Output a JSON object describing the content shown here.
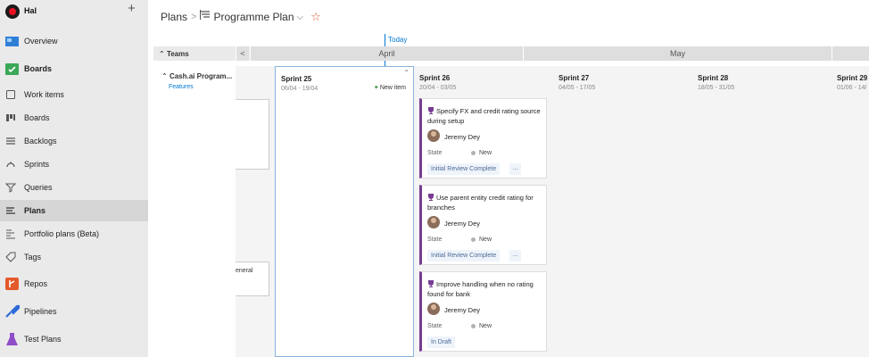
{
  "sidebar": {
    "org_name": "Hal",
    "add_label": "+",
    "items": [
      {
        "label": "Overview",
        "icon": "overview-icon"
      },
      {
        "label": "Boards",
        "icon": "boards-hub-icon"
      },
      {
        "label": "Work items",
        "icon": "work-items-icon"
      },
      {
        "label": "Boards",
        "icon": "boards-icon"
      },
      {
        "label": "Backlogs",
        "icon": "backlogs-icon"
      },
      {
        "label": "Sprints",
        "icon": "sprints-icon"
      },
      {
        "label": "Queries",
        "icon": "queries-icon"
      },
      {
        "label": "Plans",
        "icon": "plans-icon"
      },
      {
        "label": "Portfolio plans (Beta)",
        "icon": "portfolio-plans-icon"
      },
      {
        "label": "Tags",
        "icon": "tags-icon"
      },
      {
        "label": "Repos",
        "icon": "repos-icon"
      },
      {
        "label": "Pipelines",
        "icon": "pipelines-icon"
      },
      {
        "label": "Test Plans",
        "icon": "test-plans-icon"
      }
    ]
  },
  "header": {
    "breadcrumb_root": "Plans",
    "separator": ">",
    "plan_name": "Programme Plan",
    "chevron": "⌵",
    "star": "☆"
  },
  "timeline": {
    "today_label": "Today",
    "teams_header": "Teams",
    "collapse_glyph": "<",
    "months": [
      "April",
      "May"
    ]
  },
  "team": {
    "name": "Cash.ai Program...",
    "backlog_level": "Features"
  },
  "partial_card_text": "eneral",
  "sprints": [
    {
      "name": "Sprint 25",
      "dates": "06/04 - 19/04"
    },
    {
      "name": "Sprint 26",
      "dates": "20/04 - 03/05"
    },
    {
      "name": "Sprint 27",
      "dates": "04/05 - 17/05"
    },
    {
      "name": "Sprint 28",
      "dates": "18/05 - 31/05"
    },
    {
      "name": "Sprint 29",
      "dates": "01/06 - 14/"
    }
  ],
  "new_item_label": "New item",
  "cards": [
    {
      "title": "Specify FX and credit rating source during setup",
      "assignee": "Jeremy Dey",
      "state_label": "State",
      "state": "New",
      "tag": "Initial Review Complete",
      "more": "..."
    },
    {
      "title": "Use parent entity credit rating for branches",
      "assignee": "Jeremy Dey",
      "state_label": "State",
      "state": "New",
      "tag": "Initial Review Complete",
      "more": "..."
    },
    {
      "title": "Improve handling when no rating found for bank",
      "assignee": "Jeremy Dey",
      "state_label": "State",
      "state": "New",
      "tag": "In Draft"
    }
  ],
  "colors": {
    "accent": "#0078d4",
    "feature_border": "#773b93",
    "star": "#e05b3a"
  }
}
